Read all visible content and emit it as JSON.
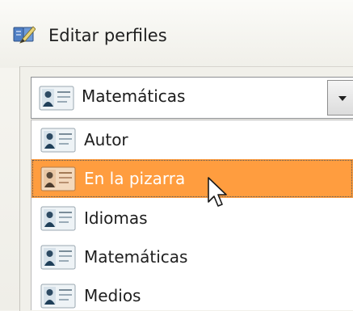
{
  "window": {
    "title": "Editar perfiles",
    "icon": "edit-profiles-icon"
  },
  "combo": {
    "selected_label": "Matemáticas",
    "icon": "profile-card-icon"
  },
  "list": {
    "items": [
      {
        "label": "Autor",
        "selected": false,
        "icon": "profile-card-icon"
      },
      {
        "label": "En la pizarra",
        "selected": true,
        "icon": "profile-card-icon"
      },
      {
        "label": "Idiomas",
        "selected": false,
        "icon": "profile-card-icon"
      },
      {
        "label": "Matemáticas",
        "selected": false,
        "icon": "profile-card-icon"
      },
      {
        "label": "Medios",
        "selected": false,
        "icon": "profile-card-icon"
      }
    ]
  },
  "colors": {
    "selection": "#ff9d3f",
    "selected_text": "#ffffff",
    "text": "#202020"
  }
}
